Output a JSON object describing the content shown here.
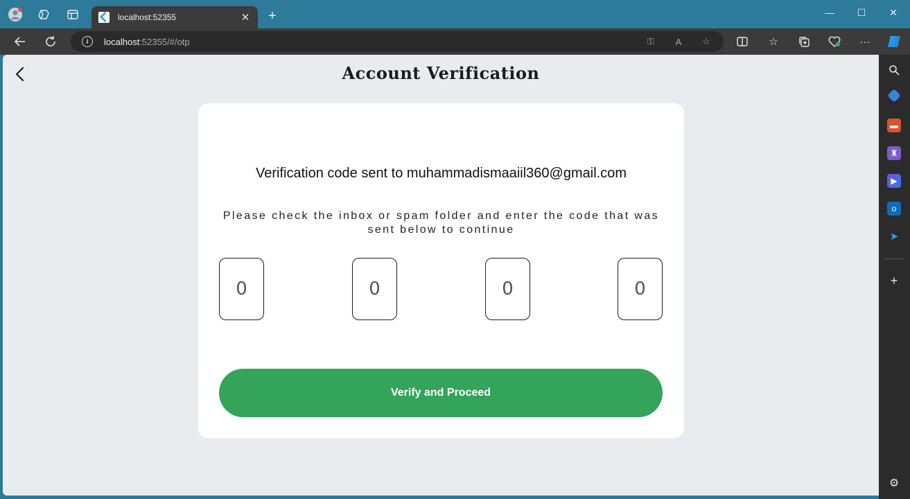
{
  "browser": {
    "tab": {
      "title": "localhost:52355"
    },
    "address": {
      "host": "localhost",
      "rest": ":52355/#/otp"
    }
  },
  "page": {
    "title": "Account Verification",
    "sent_line": "Verification code sent to muhammadismaaiil360@gmail.com",
    "instructions": "Please check the inbox or spam folder and enter the code that was sent below to continue",
    "otp_digits": [
      "0",
      "0",
      "0",
      "0"
    ],
    "verify_button": "Verify and Proceed"
  },
  "colors": {
    "titlebar": "#2d7a9a",
    "button_green": "#33a45a",
    "page_background": "#e8ecee"
  }
}
